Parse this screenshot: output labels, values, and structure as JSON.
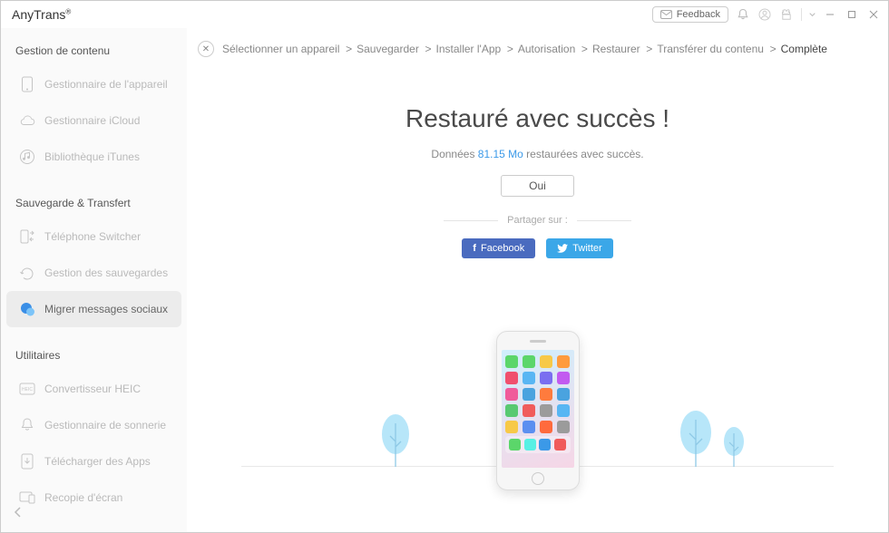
{
  "brand": "AnyTrans",
  "header": {
    "feedback": "Feedback"
  },
  "sidebar": {
    "sections": [
      {
        "title": "Gestion de contenu",
        "items": [
          {
            "label": "Gestionnaire de l'appareil",
            "icon": "phone-icon"
          },
          {
            "label": "Gestionnaire iCloud",
            "icon": "cloud-icon"
          },
          {
            "label": "Bibliothèque iTunes",
            "icon": "music-icon"
          }
        ]
      },
      {
        "title": "Sauvegarde & Transfert",
        "items": [
          {
            "label": "Téléphone Switcher",
            "icon": "switch-icon"
          },
          {
            "label": "Gestion des sauvegardes",
            "icon": "backup-icon"
          },
          {
            "label": "Migrer messages sociaux",
            "icon": "chat-icon",
            "active": true
          }
        ]
      },
      {
        "title": "Utilitaires",
        "items": [
          {
            "label": "Convertisseur HEIC",
            "icon": "heic-icon"
          },
          {
            "label": "Gestionnaire de sonnerie",
            "icon": "bell-icon"
          },
          {
            "label": "Télécharger des Apps",
            "icon": "download-icon"
          },
          {
            "label": "Recopie d'écran",
            "icon": "mirror-icon"
          }
        ]
      }
    ]
  },
  "breadcrumb": {
    "steps": [
      "Sélectionner un appareil",
      "Sauvegarder",
      "Installer l'App",
      "Autorisation",
      "Restaurer",
      "Transférer du contenu",
      "Complète"
    ],
    "active": 6
  },
  "result": {
    "title": "Restauré avec succès !",
    "before_size": "Données ",
    "size": "81.15 Mo",
    "after_size": " restaurées avec succès.",
    "ok": "Oui",
    "share_label": "Partager sur :",
    "facebook": "Facebook",
    "twitter": "Twitter"
  },
  "appcolors": [
    "#5bd66a",
    "#5bd66a",
    "#f7c948",
    "#ff9b3d",
    "#f0506e",
    "#58b6f3",
    "#7a6ff0",
    "#c25bf0",
    "#f05b9b",
    "#4aa3df",
    "#ff7b3d",
    "#4aa3df",
    "#58c972",
    "#f05b5b",
    "#9b9b9b",
    "#58b6f3",
    "#f7c948",
    "#5b8ff0",
    "#ff6a3d",
    "#9b9b9b"
  ],
  "dockcolors": [
    "#5bd66a",
    "#57f0e4",
    "#3b99e8",
    "#f05b5b"
  ]
}
